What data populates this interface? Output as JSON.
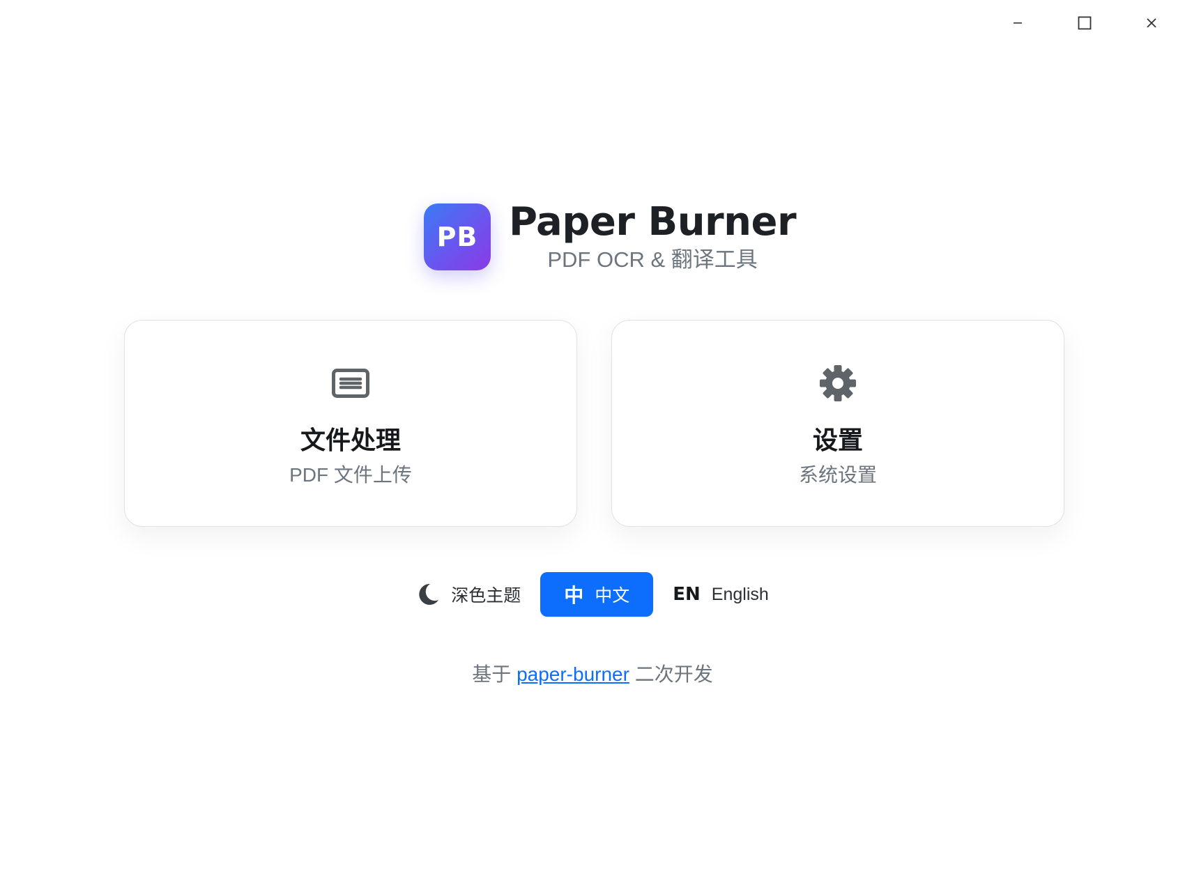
{
  "window_controls": {
    "minimize_icon": "minimize-icon",
    "maximize_icon": "maximize-icon",
    "close_icon": "close-icon"
  },
  "header": {
    "logo_text": "PB",
    "title": "Paper Burner",
    "subtitle": "PDF OCR & 翻译工具"
  },
  "cards": [
    {
      "icon": "document-icon",
      "title": "文件处理",
      "description": "PDF 文件上传"
    },
    {
      "icon": "gear-icon",
      "title": "设置",
      "description": "系统设置"
    }
  ],
  "toolbar": {
    "theme": {
      "icon": "moon-icon",
      "label": "深色主题"
    },
    "zh": {
      "icon_text": "中",
      "label": "中文",
      "active": true
    },
    "en": {
      "icon_text": "EN",
      "label": "English",
      "active": false
    }
  },
  "footer": {
    "prefix": "基于",
    "link_text": "paper-burner",
    "suffix": "二次开发"
  },
  "colors": {
    "accent": "#0d6efd",
    "logo_gradient_start": "#3a7bf4",
    "logo_gradient_end": "#8b3ae6",
    "muted_text": "#6c757d",
    "icon_gray": "#5f6468"
  }
}
